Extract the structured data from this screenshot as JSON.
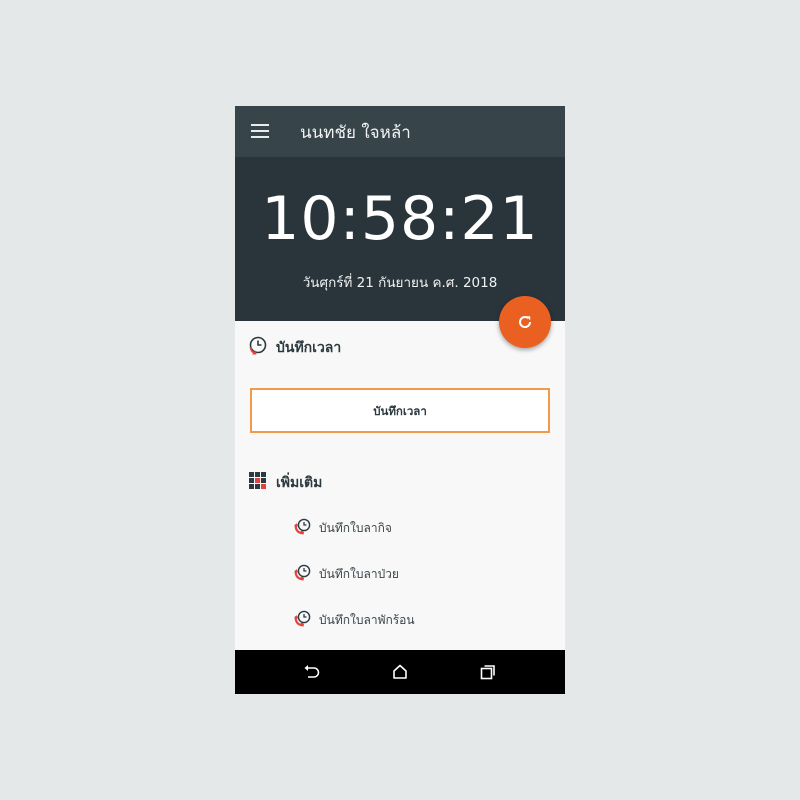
{
  "app": {
    "title": "นนทชัย ใจหล้า"
  },
  "clock": {
    "time": "10:58:21",
    "date": "วันศุกร์ที่ 21 กันยายน ค.ศ. 2018"
  },
  "sections": {
    "record": {
      "heading": "บันทึกเวลา",
      "button_label": "บันทึกเวลา"
    },
    "more": {
      "heading": "เพิ่มเติม",
      "items": [
        {
          "label": "บันทึกใบลากิจ",
          "icon": "phone-clock-icon"
        },
        {
          "label": "บันทึกใบลาป่วย",
          "icon": "phone-clock-icon"
        },
        {
          "label": "บันทึกใบลาพักร้อน",
          "icon": "phone-clock-icon"
        }
      ]
    }
  },
  "fab": {
    "icon": "refresh-icon"
  },
  "navbar": {
    "icons": [
      "back-icon",
      "home-icon",
      "recent-apps-icon"
    ]
  },
  "colors": {
    "appbar": "#37444a",
    "clock_panel": "#29353b",
    "accent": "#ea6020",
    "button_border": "#ef9a4c"
  }
}
